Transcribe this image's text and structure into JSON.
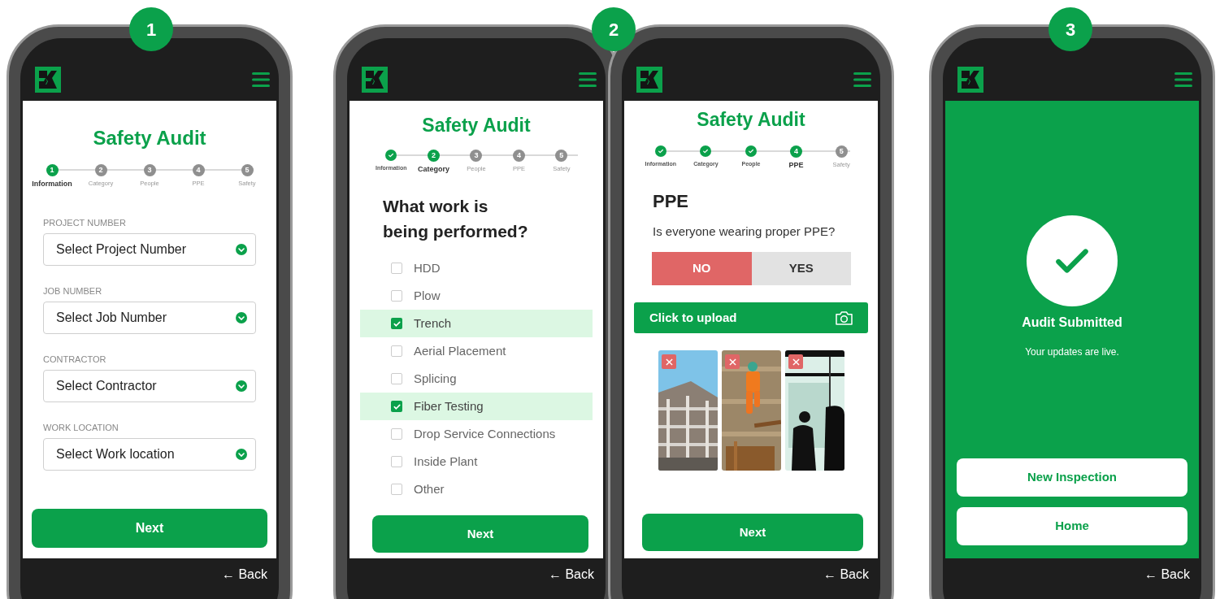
{
  "badges": [
    "1",
    "2",
    "3"
  ],
  "screens": [
    {
      "kind": "form",
      "title": "Safety Audit",
      "steps": [
        {
          "number": "1",
          "label": "Information",
          "done": false,
          "selected": true
        },
        {
          "number": "2",
          "label": "Category",
          "done": false,
          "selected": false
        },
        {
          "number": "3",
          "label": "People",
          "done": false,
          "selected": false
        },
        {
          "number": "4",
          "label": "PPE",
          "done": false,
          "selected": false
        },
        {
          "number": "5",
          "label": "Safety",
          "done": false,
          "selected": false
        }
      ],
      "fields": [
        {
          "label": "PROJECT NUMBER",
          "value": "Select Project Number"
        },
        {
          "label": "JOB NUMBER",
          "value": "Select Job Number"
        },
        {
          "label": "CONTRACTOR",
          "value": "Select Contractor"
        },
        {
          "label": "WORK LOCATION",
          "value": "Select Work location"
        }
      ],
      "next": "Next",
      "back": "← Back"
    },
    {
      "kind": "checklist",
      "title": "Safety Audit",
      "steps": [
        {
          "label": "Information",
          "done": true,
          "selected": false
        },
        {
          "number": "2",
          "label": "Category",
          "done": false,
          "selected": true
        },
        {
          "number": "3",
          "label": "People",
          "done": false,
          "selected": false
        },
        {
          "number": "4",
          "label": "PPE",
          "done": false,
          "selected": false
        },
        {
          "number": "5",
          "label": "Safety",
          "done": false,
          "selected": false
        }
      ],
      "question": "What work is being performed?",
      "options": [
        {
          "label": "HDD",
          "checked": false
        },
        {
          "label": "Plow",
          "checked": false
        },
        {
          "label": "Trench",
          "checked": true
        },
        {
          "label": "Aerial Placement",
          "checked": false
        },
        {
          "label": "Splicing",
          "checked": false
        },
        {
          "label": "Fiber Testing",
          "checked": true
        },
        {
          "label": "Drop Service Connections",
          "checked": false
        },
        {
          "label": "Inside Plant",
          "checked": false
        },
        {
          "label": "Other",
          "checked": false
        }
      ],
      "next": "Next",
      "back": "← Back"
    },
    {
      "kind": "ppe",
      "title": "Safety Audit",
      "steps": [
        {
          "label": "Information",
          "done": true,
          "selected": false
        },
        {
          "label": "Category",
          "done": true,
          "selected": false
        },
        {
          "label": "People",
          "done": true,
          "selected": false
        },
        {
          "number": "4",
          "label": "PPE",
          "done": false,
          "selected": true
        },
        {
          "number": "5",
          "label": "Safety",
          "done": false,
          "selected": false
        }
      ],
      "heading": "PPE",
      "question": "Is everyone wearing proper PPE?",
      "answers": [
        {
          "label": "NO",
          "selected": true
        },
        {
          "label": "YES",
          "selected": false
        }
      ],
      "upload": "Click to upload",
      "photos": [
        {
          "kind": "picture"
        },
        {
          "kind": "picture"
        },
        {
          "kind": "picture"
        }
      ],
      "next": "Next",
      "back": "← Back"
    },
    {
      "kind": "success",
      "heading": "Audit Submitted",
      "message": "Your updates are live.",
      "buttons": [
        "New Inspection",
        "Home"
      ],
      "back": "← Back"
    }
  ]
}
